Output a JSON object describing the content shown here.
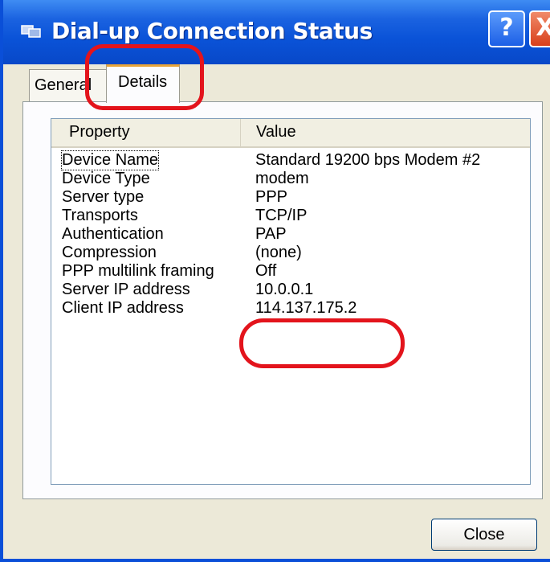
{
  "window": {
    "title": "Dial-up Connection Status",
    "help_glyph": "?",
    "close_glyph": "X"
  },
  "tabs": [
    {
      "label": "General",
      "selected": false
    },
    {
      "label": "Details",
      "selected": true
    }
  ],
  "details": {
    "columns": [
      "Property",
      "Value"
    ],
    "rows": [
      {
        "property": "Device Name",
        "value": "Standard 19200 bps Modem #2"
      },
      {
        "property": "Device Type",
        "value": "modem"
      },
      {
        "property": "Server type",
        "value": "PPP"
      },
      {
        "property": "Transports",
        "value": "TCP/IP"
      },
      {
        "property": "Authentication",
        "value": "PAP"
      },
      {
        "property": "Compression",
        "value": "(none)"
      },
      {
        "property": "PPP multilink framing",
        "value": "Off"
      },
      {
        "property": "Server IP address",
        "value": "10.0.0.1"
      },
      {
        "property": "Client IP address",
        "value": "114.137.175.2"
      }
    ]
  },
  "buttons": {
    "close_label": "Close"
  },
  "colors": {
    "titlebar": "#0a53d8",
    "annotation": "#e3141c",
    "dialog_bg": "#ece9d8"
  }
}
